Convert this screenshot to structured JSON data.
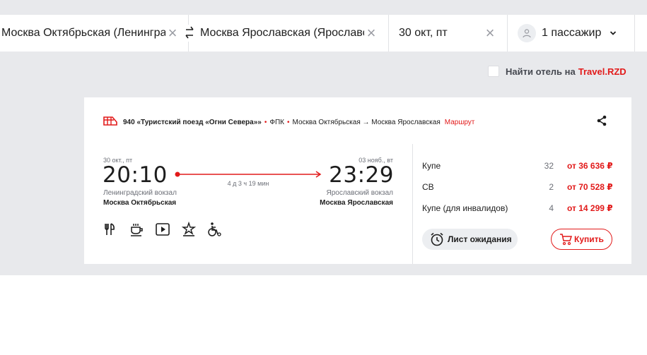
{
  "search": {
    "from": "Москва Октябрьская (Ленинградский вокзал)",
    "to": "Москва Ярославская (Ярославский вокзал)",
    "date": "30 окт, пт",
    "passengers": "1 пассажир"
  },
  "hotel": {
    "label": "Найти отель на",
    "brand": "Travel.RZD"
  },
  "train": {
    "number_name": "940 «Туристский поезд «Огни Севера»»",
    "carrier": "ФПК",
    "route": "Москва Октябрьская → Москва Ярославская",
    "route_link": "Маршрут",
    "departure": {
      "date": "30 окт., пт",
      "time": "20:10",
      "station": "Ленинградский вокзал",
      "city": "Москва Октябрьская"
    },
    "arrival": {
      "date": "03 нояб., вт",
      "time": "23:29",
      "station": "Ярославский вокзал",
      "city": "Москва Ярославская"
    },
    "duration": "4 д 3 ч 19 мин",
    "amenities": [
      "restaurant-icon",
      "coffee-icon",
      "video-icon",
      "star-service-icon",
      "wheelchair-icon"
    ]
  },
  "cars": [
    {
      "name": "Купе",
      "seats": "32",
      "price": "от 36 636 ₽"
    },
    {
      "name": "СВ",
      "seats": "2",
      "price": "от 70 528 ₽"
    },
    {
      "name": "Купе (для инвалидов)",
      "seats": "4",
      "price": "от 14 299 ₽"
    }
  ],
  "buttons": {
    "wait_list": "Лист ожидания",
    "buy": "Купить"
  },
  "colors": {
    "accent": "#e21a1a",
    "background": "#e8e9ec"
  }
}
